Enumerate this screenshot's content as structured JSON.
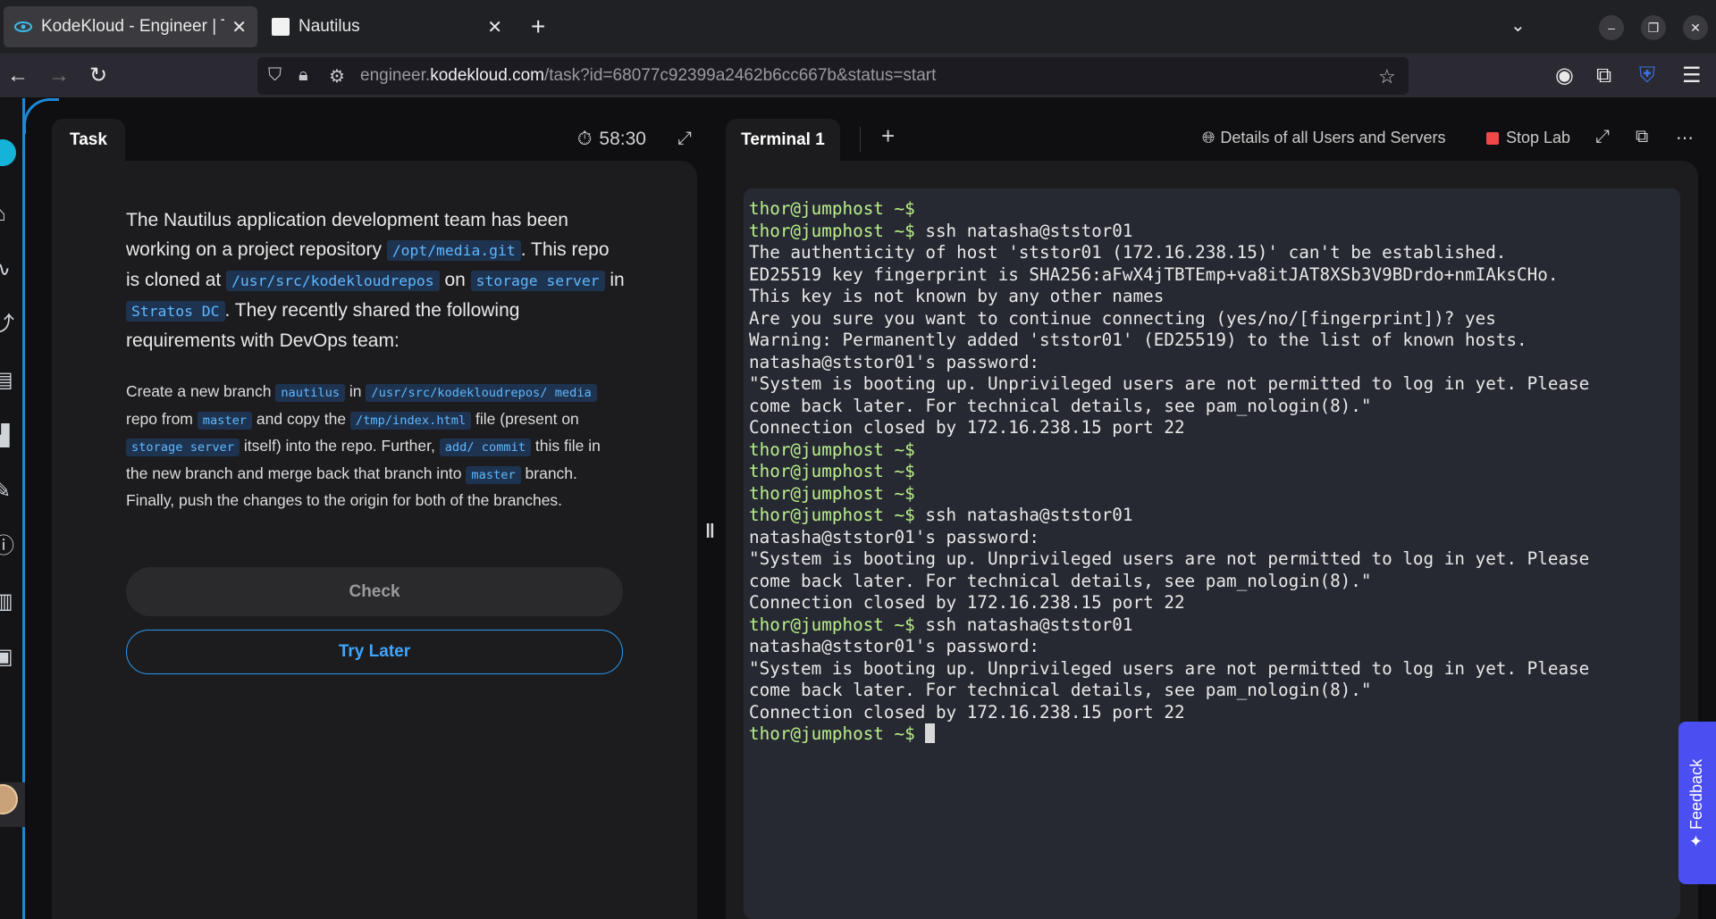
{
  "browser": {
    "tabs": [
      {
        "title": "KodeKloud - Engineer | Ta",
        "favicon": "kodekloud-eye-icon",
        "active": true
      },
      {
        "title": "Nautilus",
        "favicon": "blank-page-icon",
        "active": false
      }
    ],
    "url": {
      "prefix": "engineer.",
      "host": "kodekloud.com",
      "path": "/task?id=68077c92399a2462b6cc667b&status=start"
    }
  },
  "task_panel": {
    "tab_label": "Task",
    "timer": "58:30",
    "intro": {
      "t1": "The Nautilus application development team has been working on a project repository ",
      "c1": "/opt/media.git",
      "t2": ". This repo is cloned at ",
      "c2": "/usr/src/kodekloudrepos",
      "t3": " on ",
      "c3": "storage server",
      "t4": " in ",
      "c4": "Stratos DC",
      "t5": ". They recently shared the following requirements with DevOps team:"
    },
    "instructions": {
      "t1": "Create a new branch ",
      "c1": "nautilus",
      "t2": " in ",
      "c2": "/usr/src/kodekloudrepos/ media",
      "t3": " repo from ",
      "c3": "master",
      "t4": " and copy the ",
      "c4": "/tmp/index.html",
      "t5": " file (present on ",
      "c5": "storage server",
      "t6": " itself) into the repo. Further, ",
      "c6": "add/ commit",
      "t7": " this file in the new branch and merge back that branch into ",
      "c7": "master",
      "t8": " branch. Finally, push the changes to the origin for both of the branches."
    },
    "check_label": "Check",
    "try_later_label": "Try Later"
  },
  "terminal_panel": {
    "tab_label": "Terminal 1",
    "details_label": "Details of all Users and Servers",
    "stop_label": "Stop Lab",
    "lines": [
      {
        "prompt": "thor@jumphost ~$",
        "text": ""
      },
      {
        "prompt": "thor@jumphost ~$",
        "text": " ssh natasha@ststor01"
      },
      {
        "prompt": "",
        "text": "The authenticity of host 'ststor01 (172.16.238.15)' can't be established."
      },
      {
        "prompt": "",
        "text": "ED25519 key fingerprint is SHA256:aFwX4jTBTEmp+va8itJAT8XSb3V9BDrdo+nmIAksCHo."
      },
      {
        "prompt": "",
        "text": "This key is not known by any other names"
      },
      {
        "prompt": "",
        "text": "Are you sure you want to continue connecting (yes/no/[fingerprint])? yes"
      },
      {
        "prompt": "",
        "text": "Warning: Permanently added 'ststor01' (ED25519) to the list of known hosts."
      },
      {
        "prompt": "",
        "text": "natasha@ststor01's password:"
      },
      {
        "prompt": "",
        "text": "\"System is booting up. Unprivileged users are not permitted to log in yet. Please"
      },
      {
        "prompt": "",
        "text": "come back later. For technical details, see pam_nologin(8).\""
      },
      {
        "prompt": "",
        "text": "Connection closed by 172.16.238.15 port 22"
      },
      {
        "prompt": "thor@jumphost ~$",
        "text": ""
      },
      {
        "prompt": "thor@jumphost ~$",
        "text": ""
      },
      {
        "prompt": "thor@jumphost ~$",
        "text": ""
      },
      {
        "prompt": "thor@jumphost ~$",
        "text": " ssh natasha@ststor01"
      },
      {
        "prompt": "",
        "text": "natasha@ststor01's password:"
      },
      {
        "prompt": "",
        "text": "\"System is booting up. Unprivileged users are not permitted to log in yet. Please"
      },
      {
        "prompt": "",
        "text": "come back later. For technical details, see pam_nologin(8).\""
      },
      {
        "prompt": "",
        "text": "Connection closed by 172.16.238.15 port 22"
      },
      {
        "prompt": "thor@jumphost ~$",
        "text": " ssh natasha@ststor01"
      },
      {
        "prompt": "",
        "text": "natasha@ststor01's password:"
      },
      {
        "prompt": "",
        "text": "\"System is booting up. Unprivileged users are not permitted to log in yet. Please"
      },
      {
        "prompt": "",
        "text": "come back later. For technical details, see pam_nologin(8).\""
      },
      {
        "prompt": "",
        "text": "Connection closed by 172.16.238.15 port 22"
      },
      {
        "prompt": "thor@jumphost ~$",
        "text": " ",
        "cursor": true
      }
    ]
  },
  "feedback_label": "Feedback",
  "colors": {
    "accent": "#2b9af3",
    "prompt_green": "#b8f08a",
    "stop_red": "#f04848",
    "feedback_purple": "#4b4ef0"
  }
}
